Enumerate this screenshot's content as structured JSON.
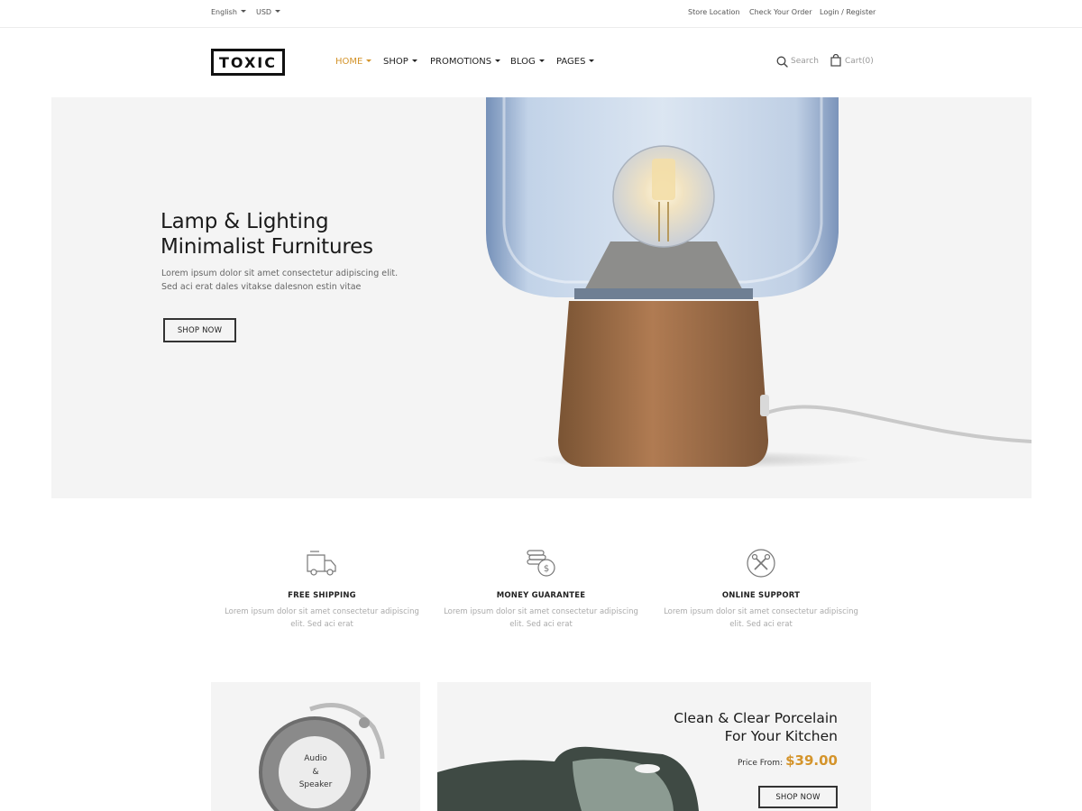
{
  "topbar": {
    "language": "English",
    "currency": "USD",
    "store_location": "Store Location",
    "check_order": "Check Your Order",
    "login_register": "Login / Register"
  },
  "header": {
    "logo": "TOXIC",
    "nav": [
      {
        "label": "HOME",
        "active": true
      },
      {
        "label": "SHOP",
        "active": false
      },
      {
        "label": "PROMOTIONS",
        "active": false
      },
      {
        "label": "BLOG",
        "active": false
      },
      {
        "label": "PAGES",
        "active": false
      }
    ],
    "search_label": "Search",
    "cart_label": "Cart(0)",
    "search_icon": "search-icon",
    "cart_icon": "shopping-bag-icon"
  },
  "hero": {
    "title_line1": "Lamp & Lighting",
    "title_line2": "Minimalist Furnitures",
    "text_line1": "Lorem ipsum dolor sit amet consectetur adipiscing elit.",
    "text_line2": "Sed aci erat dales vitakse dalesnon estin vitae",
    "button": "SHOP NOW",
    "image": "glass-lamp-with-cork-base"
  },
  "features": [
    {
      "icon": "delivery-truck-icon",
      "title": "FREE SHIPPING",
      "text_line1": "Lorem ipsum dolor sit amet consectetur adipiscing",
      "text_line2": "elit. Sed aci erat"
    },
    {
      "icon": "coins-dollar-icon",
      "title": "MONEY GUARANTEE",
      "text_line1": "Lorem ipsum dolor sit amet consectetur adipiscing",
      "text_line2": "elit. Sed aci erat"
    },
    {
      "icon": "tools-support-icon",
      "title": "ONLINE SUPPORT",
      "text_line1": "Lorem ipsum dolor sit amet consectetur adipiscing",
      "text_line2": "elit. Sed aci erat"
    }
  ],
  "banners": {
    "left": {
      "speaker_line1": "Audio",
      "speaker_line2": "&",
      "speaker_line3": "Speaker"
    },
    "right": {
      "title_line1": "Clean & Clear Porcelain",
      "title_line2": "For Your Kitchen",
      "price_label": "Price From:",
      "price_value": "$39.00",
      "button": "SHOP NOW"
    }
  },
  "colors": {
    "accent": "#d4942b",
    "hero_bg": "#f4f4f4",
    "text_dark": "#1a1a1a",
    "text_muted": "#aaaaaa"
  }
}
